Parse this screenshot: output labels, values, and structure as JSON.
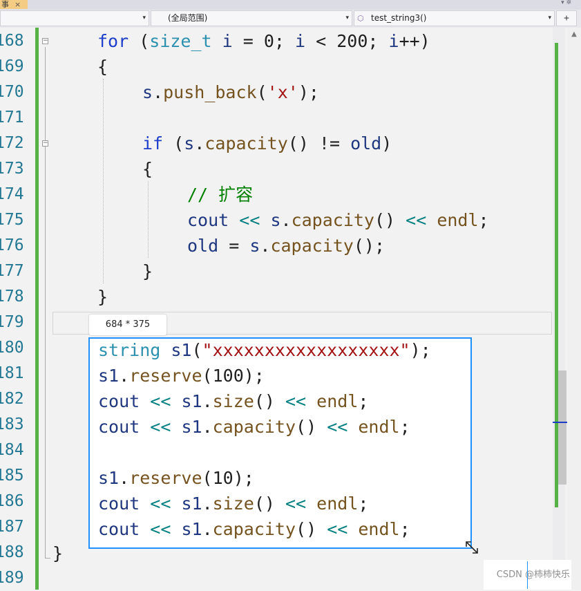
{
  "tab": {
    "label": "事",
    "close_glyph": "×"
  },
  "toolbar": {
    "project_dropdown": "",
    "scope_dropdown": "(全局范围)",
    "member_dropdown": "test_string3()",
    "dropdown_arrow": "▾",
    "split_glyph": "+"
  },
  "line_numbers": [
    "168",
    "169",
    "170",
    "171",
    "172",
    "173",
    "174",
    "175",
    "176",
    "177",
    "178",
    "179",
    "180",
    "181",
    "182",
    "183",
    "184",
    "185",
    "186",
    "187",
    "188",
    "189"
  ],
  "code": {
    "l168": [
      [
        "kw",
        "for"
      ],
      [
        "pl",
        " ("
      ],
      [
        "ty",
        "size_t"
      ],
      [
        "pl",
        " "
      ],
      [
        "var",
        "i"
      ],
      [
        "pl",
        " = "
      ],
      [
        "num",
        "0"
      ],
      [
        "pl",
        "; "
      ],
      [
        "var",
        "i"
      ],
      [
        "pl",
        " < "
      ],
      [
        "num",
        "200"
      ],
      [
        "pl",
        "; "
      ],
      [
        "var",
        "i"
      ],
      [
        "pl",
        "++)"
      ]
    ],
    "l169": [
      [
        "pl",
        "{"
      ]
    ],
    "l170": [
      [
        "var",
        "s"
      ],
      [
        "pl",
        "."
      ],
      [
        "fn",
        "push_back"
      ],
      [
        "pl",
        "("
      ],
      [
        "str",
        "'x'"
      ],
      [
        "pl",
        ");"
      ]
    ],
    "l172": [
      [
        "kw",
        "if"
      ],
      [
        "pl",
        " ("
      ],
      [
        "var",
        "s"
      ],
      [
        "pl",
        "."
      ],
      [
        "fn",
        "capacity"
      ],
      [
        "pl",
        "() != "
      ],
      [
        "var",
        "old"
      ],
      [
        "pl",
        ")"
      ]
    ],
    "l173": [
      [
        "pl",
        "{"
      ]
    ],
    "l174": [
      [
        "cmt",
        "// 扩容"
      ]
    ],
    "l175": [
      [
        "var",
        "cout"
      ],
      [
        "pl",
        " "
      ],
      [
        "op",
        "<<"
      ],
      [
        "pl",
        " "
      ],
      [
        "var",
        "s"
      ],
      [
        "pl",
        "."
      ],
      [
        "fn",
        "capacity"
      ],
      [
        "pl",
        "() "
      ],
      [
        "op",
        "<<"
      ],
      [
        "pl",
        " "
      ],
      [
        "fn",
        "endl"
      ],
      [
        "pl",
        ";"
      ]
    ],
    "l176": [
      [
        "var",
        "old"
      ],
      [
        "pl",
        " = "
      ],
      [
        "var",
        "s"
      ],
      [
        "pl",
        "."
      ],
      [
        "fn",
        "capacity"
      ],
      [
        "pl",
        "();"
      ]
    ],
    "l177": [
      [
        "pl",
        "}"
      ]
    ],
    "l178": [
      [
        "pl",
        "}"
      ]
    ],
    "l180": [
      [
        "ty",
        "string"
      ],
      [
        "pl",
        " "
      ],
      [
        "var",
        "s1"
      ],
      [
        "pl",
        "("
      ],
      [
        "str",
        "\"xxxxxxxxxxxxxxxxxx\""
      ],
      [
        "pl",
        ");"
      ]
    ],
    "l181": [
      [
        "var",
        "s1"
      ],
      [
        "pl",
        "."
      ],
      [
        "fn",
        "reserve"
      ],
      [
        "pl",
        "("
      ],
      [
        "num",
        "100"
      ],
      [
        "pl",
        ");"
      ]
    ],
    "l182": [
      [
        "var",
        "cout"
      ],
      [
        "pl",
        " "
      ],
      [
        "op",
        "<<"
      ],
      [
        "pl",
        " "
      ],
      [
        "var",
        "s1"
      ],
      [
        "pl",
        "."
      ],
      [
        "fn",
        "size"
      ],
      [
        "pl",
        "() "
      ],
      [
        "op",
        "<<"
      ],
      [
        "pl",
        " "
      ],
      [
        "fn",
        "endl"
      ],
      [
        "pl",
        ";"
      ]
    ],
    "l183": [
      [
        "var",
        "cout"
      ],
      [
        "pl",
        " "
      ],
      [
        "op",
        "<<"
      ],
      [
        "pl",
        " "
      ],
      [
        "var",
        "s1"
      ],
      [
        "pl",
        "."
      ],
      [
        "fn",
        "capacity"
      ],
      [
        "pl",
        "() "
      ],
      [
        "op",
        "<<"
      ],
      [
        "pl",
        " "
      ],
      [
        "fn",
        "endl"
      ],
      [
        "pl",
        ";"
      ]
    ],
    "l185": [
      [
        "var",
        "s1"
      ],
      [
        "pl",
        "."
      ],
      [
        "fn",
        "reserve"
      ],
      [
        "pl",
        "("
      ],
      [
        "num",
        "10"
      ],
      [
        "pl",
        ");"
      ]
    ],
    "l186": [
      [
        "var",
        "cout"
      ],
      [
        "pl",
        " "
      ],
      [
        "op",
        "<<"
      ],
      [
        "pl",
        " "
      ],
      [
        "var",
        "s1"
      ],
      [
        "pl",
        "."
      ],
      [
        "fn",
        "size"
      ],
      [
        "pl",
        "() "
      ],
      [
        "op",
        "<<"
      ],
      [
        "pl",
        " "
      ],
      [
        "fn",
        "endl"
      ],
      [
        "pl",
        ";"
      ]
    ],
    "l187": [
      [
        "var",
        "cout"
      ],
      [
        "pl",
        " "
      ],
      [
        "op",
        "<<"
      ],
      [
        "pl",
        " "
      ],
      [
        "var",
        "s1"
      ],
      [
        "pl",
        "."
      ],
      [
        "fn",
        "capacity"
      ],
      [
        "pl",
        "() "
      ],
      [
        "op",
        "<<"
      ],
      [
        "pl",
        " "
      ],
      [
        "fn",
        "endl"
      ],
      [
        "pl",
        ";"
      ]
    ],
    "l188": [
      [
        "pl",
        "}"
      ]
    ]
  },
  "selection": {
    "size_label": "684 * 375"
  },
  "fold_glyph": "−",
  "watermark": "CSDN @柿柿快乐",
  "colors": {
    "keyword": "#1d3fcb",
    "type": "#2b91af",
    "string": "#a31515",
    "comment": "#008000",
    "function": "#74531f",
    "change_bar": "#57b246",
    "selection_border": "#1e90ff"
  },
  "icons": {
    "member": "cube-icon",
    "resize": "resize-arrow-icon"
  }
}
